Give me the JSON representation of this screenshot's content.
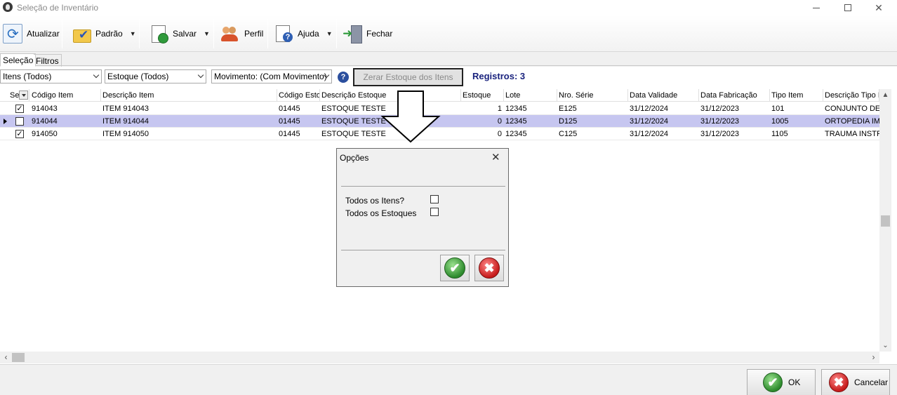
{
  "window": {
    "title": "Seleção de Inventário"
  },
  "toolbar": {
    "atualizar": "Atualizar",
    "padrao": "Padrão",
    "salvar": "Salvar",
    "perfil": "Perfil",
    "ajuda": "Ajuda",
    "fechar": "Fechar"
  },
  "tabs": [
    {
      "label": "Seleção"
    },
    {
      "label": "Filtros"
    }
  ],
  "filters": {
    "itens": "Itens (Todos)",
    "estoque": "Estoque (Todos)",
    "movimento": "Movimento: (Com Movimento)",
    "help": "?",
    "zerar": "Zerar Estoque dos Itens",
    "registros": "Registros: 3"
  },
  "grid": {
    "columns": [
      "Se",
      "Código Item",
      "Descrição Item",
      "Código Esto",
      "Descrição Estoque",
      "Estoque",
      "Lote",
      "Nro. Série",
      "Data Validade",
      "Data Fabricação",
      "Tipo Item",
      "Descrição Tipo I"
    ],
    "rows": [
      {
        "checked": "✓",
        "codigo": "914043",
        "descricao": "ITEM 914043",
        "cod_estoque": "01445",
        "desc_estoque": "ESTOQUE TESTE",
        "estoque": "1",
        "lote": "12345",
        "serie": "E125",
        "validade": "31/12/2024",
        "fabricacao": "31/12/2023",
        "tipo": "101",
        "desc_tipo": "CONJUNTO DE I"
      },
      {
        "checked": "",
        "codigo": "914044",
        "descricao": "ITEM 914044",
        "cod_estoque": "01445",
        "desc_estoque": "ESTOQUE TESTE",
        "estoque": "0",
        "lote": "12345",
        "serie": "D125",
        "validade": "31/12/2024",
        "fabricacao": "31/12/2023",
        "tipo": "1005",
        "desc_tipo": "ORTOPEDIA IMP"
      },
      {
        "checked": "✓",
        "codigo": "914050",
        "descricao": "ITEM 914050",
        "cod_estoque": "01445",
        "desc_estoque": "ESTOQUE TESTE",
        "estoque": "0",
        "lote": "12345",
        "serie": "C125",
        "validade": "31/12/2024",
        "fabricacao": "31/12/2023",
        "tipo": "1105",
        "desc_tipo": "TRAUMA INSTRU"
      }
    ]
  },
  "dialog": {
    "title": "Opções",
    "close": "✕",
    "todos_itens": "Todos os Itens?",
    "todos_estoques": "Todos os Estoques",
    "ok_glyph": "✔",
    "cancel_glyph": "✖"
  },
  "bottom": {
    "ok": "OK",
    "cancelar": "Cancelar",
    "ok_glyph": "✔",
    "cancel_glyph": "✖"
  },
  "colors": {
    "selected_row": "#c6c6f0",
    "registros": "#1a237e"
  }
}
